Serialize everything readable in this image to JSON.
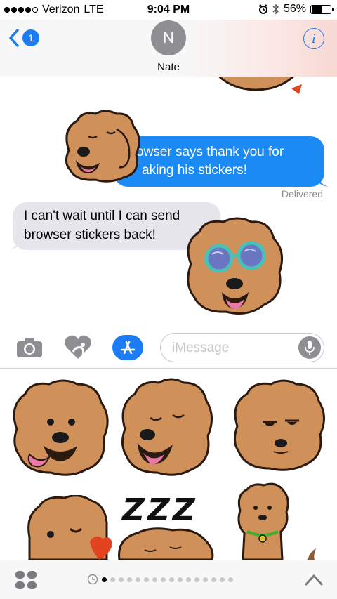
{
  "status_bar": {
    "carrier": "Verizon",
    "network": "LTE",
    "time": "9:04 PM",
    "battery": "56%",
    "battery_level": 0.56,
    "signal_bars": 4,
    "signal_max": 5
  },
  "nav": {
    "back_badge": "1",
    "contact_initial": "N",
    "contact_name": "Nate",
    "info_label": "i"
  },
  "conversation": {
    "outgoing_message": "owser says thank you for making his stickers!",
    "outgoing_line1": "owser says thank you for",
    "outgoing_line2": "aking his stickers!",
    "delivered_label": "Delivered",
    "incoming_line1": "I can't wait until I can send",
    "incoming_line2": "browser stickers back!"
  },
  "input": {
    "placeholder": "iMessage"
  },
  "drawer": {
    "zzz_text": "ZZZ",
    "page_count": 16,
    "active_page": 1
  },
  "colors": {
    "accent": "#1b7cf5",
    "bubble_out": "#1b8af5",
    "bubble_in": "#e6e5eb",
    "dog_fur": "#d0905a",
    "dog_outline": "#2a1a10"
  }
}
